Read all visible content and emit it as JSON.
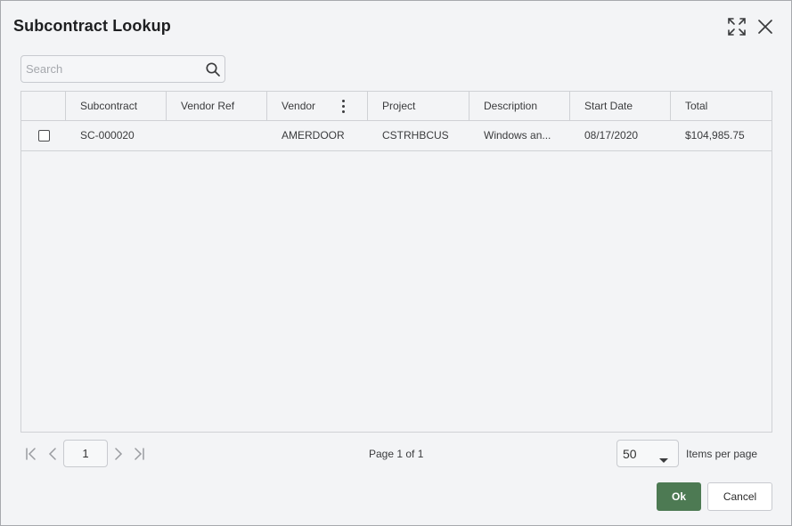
{
  "dialog": {
    "title": "Subcontract Lookup",
    "expand_icon": "expand-icon",
    "close_icon": "close-icon"
  },
  "search": {
    "placeholder": "Search",
    "value": "",
    "icon": "search-icon"
  },
  "grid": {
    "columns": [
      "Subcontract",
      "Vendor Ref",
      "Vendor",
      "Project",
      "Description",
      "Start Date",
      "Total"
    ],
    "rows": [
      {
        "checked": false,
        "subcontract": "SC-000020",
        "vendor_ref": "",
        "vendor": "AMERDOOR",
        "project": "CSTRHBCUS",
        "description": "Windows an...",
        "start_date": "08/17/2020",
        "total": "$104,985.75"
      }
    ]
  },
  "pager": {
    "current_page": "1",
    "page_info": "Page 1 of 1",
    "items_per_page": "50",
    "items_per_page_label": "Items per page"
  },
  "actions": {
    "ok_label": "Ok",
    "cancel_label": "Cancel"
  },
  "colors": {
    "accent": "#4d7a53",
    "background": "#f3f4f6",
    "border": "#cfd1d5"
  }
}
